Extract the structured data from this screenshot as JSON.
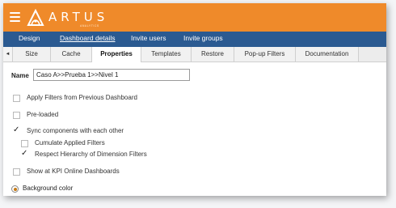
{
  "brand": {
    "name": "ARTUS",
    "subtitle": "ANALYTICS"
  },
  "colors": {
    "topbar": "#ef8a2a",
    "navbar": "#2b5a91",
    "radio_accent": "#c77a14"
  },
  "nav": {
    "items": [
      {
        "label": "Design"
      },
      {
        "label": "Dashboard details",
        "active": true
      },
      {
        "label": "Invite users"
      },
      {
        "label": "Invite groups"
      }
    ]
  },
  "tabs": {
    "prev_arrow": "◄",
    "items": [
      {
        "label": "Size"
      },
      {
        "label": "Cache"
      },
      {
        "label": "Properties",
        "selected": true
      },
      {
        "label": "Templates"
      },
      {
        "label": "Restore"
      },
      {
        "label": "Pop-up Filters"
      },
      {
        "label": "Documentation"
      }
    ]
  },
  "form": {
    "name_label": "Name",
    "name_value": "Caso A>>Prueba 1>>Nivel 1",
    "options": [
      {
        "label": "Apply Filters from Previous Dashboard",
        "checked": false
      },
      {
        "label": "Pre-loaded",
        "checked": false
      },
      {
        "label": "Sync components with each other",
        "checked": true
      },
      {
        "label": "Cumulate Applied Filters",
        "checked": false
      },
      {
        "label": "Respect Hierarchy of Dimension Filters",
        "checked": true
      },
      {
        "label": "Show at KPI Online Dashboards",
        "checked": false
      }
    ],
    "background_label": "Background color",
    "check_glyph": "✓"
  }
}
